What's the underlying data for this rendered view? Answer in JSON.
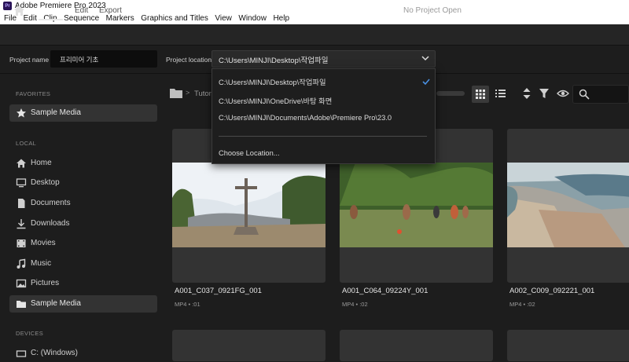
{
  "window": {
    "title": "Adobe Premiere Pro 2023",
    "app_badge": "Pr"
  },
  "menu": [
    "File",
    "Edit",
    "Clip",
    "Sequence",
    "Markers",
    "Graphics and Titles",
    "View",
    "Window",
    "Help"
  ],
  "header": {
    "tabs": [
      {
        "label": "Import",
        "state": "active"
      },
      {
        "label": "Edit",
        "state": "disabled"
      },
      {
        "label": "Export",
        "state": "disabled"
      }
    ],
    "status": "No Project Open"
  },
  "project": {
    "name_label": "Project name",
    "name_value": "프리미어 기초",
    "location_label": "Project location",
    "location_value": "C:\\Users\\MINJI\\Desktop\\작업파일"
  },
  "dropdown": {
    "items": [
      {
        "label": "C:\\Users\\MINJI\\Desktop\\작업파일",
        "selected": true
      },
      {
        "label": "C:\\Users\\MINJI\\OneDrive\\바탕 화면",
        "selected": false
      },
      {
        "label": "C:\\Users\\MINJI\\Documents\\Adobe\\Premiere Pro\\23.0",
        "selected": false
      }
    ],
    "choose": "Choose Location..."
  },
  "sidebar": {
    "favorites_head": "FAVORITES",
    "favorites": [
      {
        "label": "Sample Media",
        "icon": "star-icon"
      }
    ],
    "local_head": "LOCAL",
    "local": [
      {
        "label": "Home",
        "icon": "home-icon"
      },
      {
        "label": "Desktop",
        "icon": "desktop-icon"
      },
      {
        "label": "Documents",
        "icon": "document-icon"
      },
      {
        "label": "Downloads",
        "icon": "download-icon"
      },
      {
        "label": "Movies",
        "icon": "movie-icon"
      },
      {
        "label": "Music",
        "icon": "music-icon"
      },
      {
        "label": "Pictures",
        "icon": "picture-icon"
      },
      {
        "label": "Sample Media",
        "icon": "folder-icon"
      }
    ],
    "devices_head": "DEVICES",
    "devices": [
      {
        "label": "C: (Windows)",
        "icon": "drive-icon"
      }
    ]
  },
  "browser": {
    "breadcrumb": "Tutor",
    "cards": [
      {
        "name": "A001_C037_0921FG_001",
        "meta": "MP4 • :01"
      },
      {
        "name": "A001_C064_09224Y_001",
        "meta": "MP4 • :02"
      },
      {
        "name": "A002_C009_092221_001",
        "meta": "MP4 • :02"
      }
    ]
  },
  "colors": {
    "accent_blue": "#4a90e2",
    "panel": "#1d1d1d",
    "card": "#333333"
  }
}
